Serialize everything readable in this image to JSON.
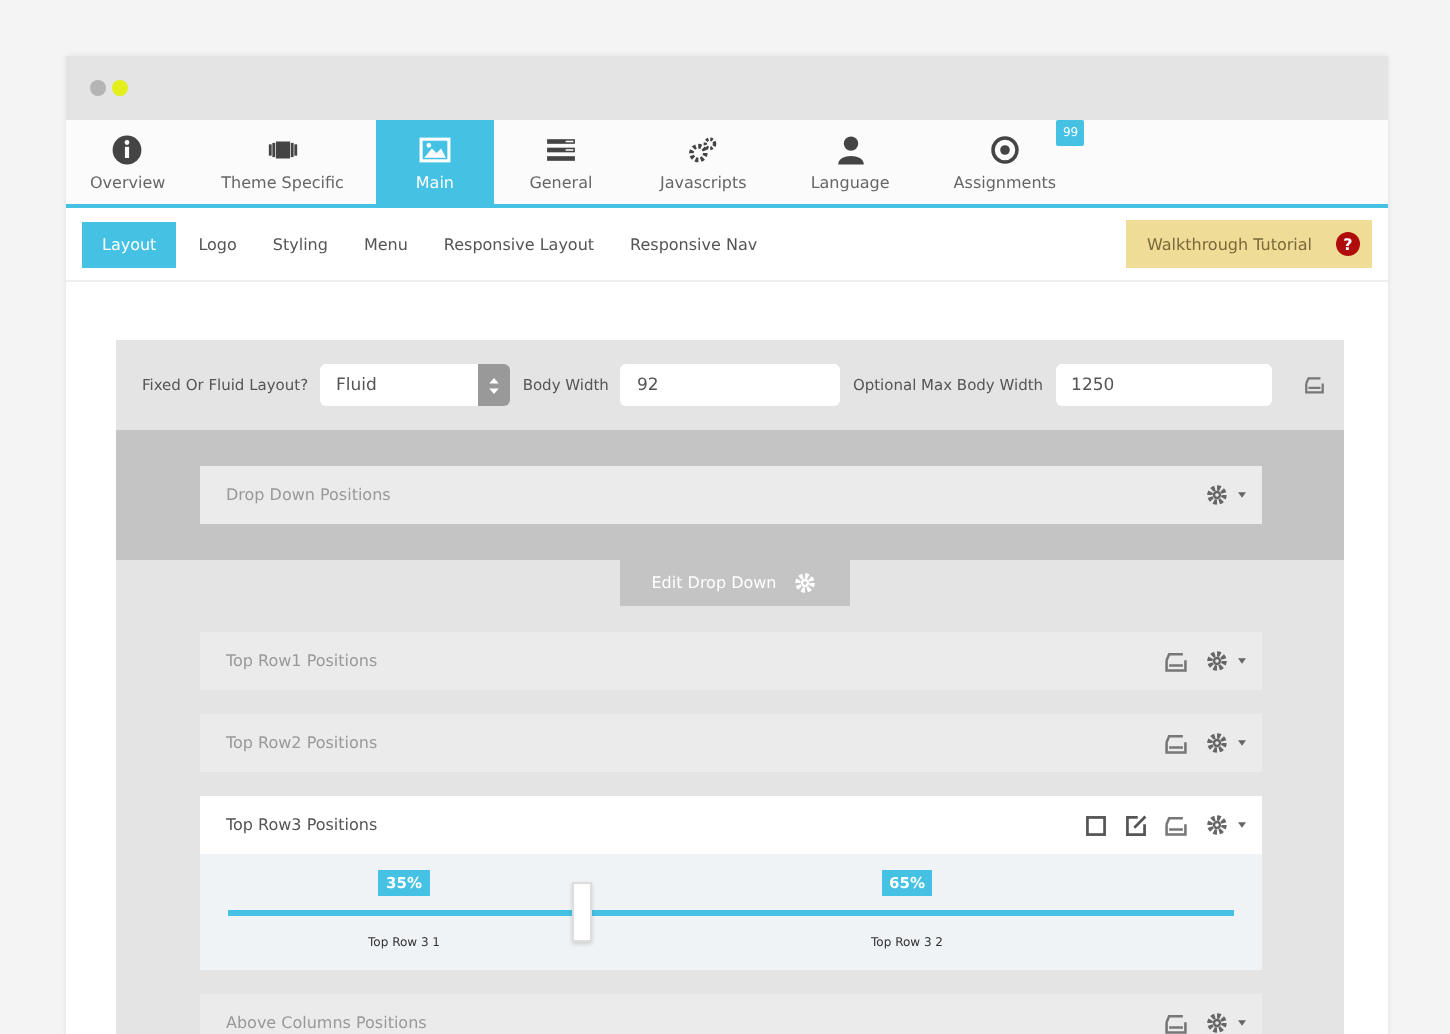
{
  "window": {
    "dots": [
      {
        "color": "#b4b4b4"
      },
      {
        "color": "#e3ee1a"
      }
    ]
  },
  "tabs": [
    {
      "label": "Overview",
      "selected": false
    },
    {
      "label": "Theme Specific",
      "selected": false
    },
    {
      "label": "Main",
      "selected": true
    },
    {
      "label": "General",
      "selected": false
    },
    {
      "label": "Javascripts",
      "selected": false
    },
    {
      "label": "Language",
      "selected": false
    },
    {
      "label": "Assignments",
      "selected": false,
      "badge": "99"
    }
  ],
  "subtabs": [
    {
      "label": "Layout",
      "selected": true
    },
    {
      "label": "Logo",
      "selected": false
    },
    {
      "label": "Styling",
      "selected": false
    },
    {
      "label": "Menu",
      "selected": false
    },
    {
      "label": "Responsive Layout",
      "selected": false
    },
    {
      "label": "Responsive Nav",
      "selected": false
    }
  ],
  "tutorial_button": {
    "label": "Walkthrough Tutorial",
    "help": "?"
  },
  "settings": {
    "layout_label": "Fixed Or Fluid Layout?",
    "layout_value": "Fluid",
    "body_width_label": "Body Width",
    "body_width_value": "92",
    "max_width_label": "Optional Max Body Width",
    "max_width_value": "1250"
  },
  "dropdown_section": {
    "title": "Drop Down Positions",
    "edit_button": "Edit Drop Down"
  },
  "rows": [
    {
      "title": "Top Row1 Positions",
      "expanded": false
    },
    {
      "title": "Top Row2 Positions",
      "expanded": false
    },
    {
      "title": "Top Row3 Positions",
      "expanded": true,
      "slider": {
        "level": 0.35,
        "columns": [
          {
            "percent": "35%",
            "name": "Top Row 3 1"
          },
          {
            "percent": "65%",
            "name": "Top Row 3 2"
          }
        ]
      }
    },
    {
      "title": "Above Columns Positions",
      "expanded": false
    }
  ]
}
